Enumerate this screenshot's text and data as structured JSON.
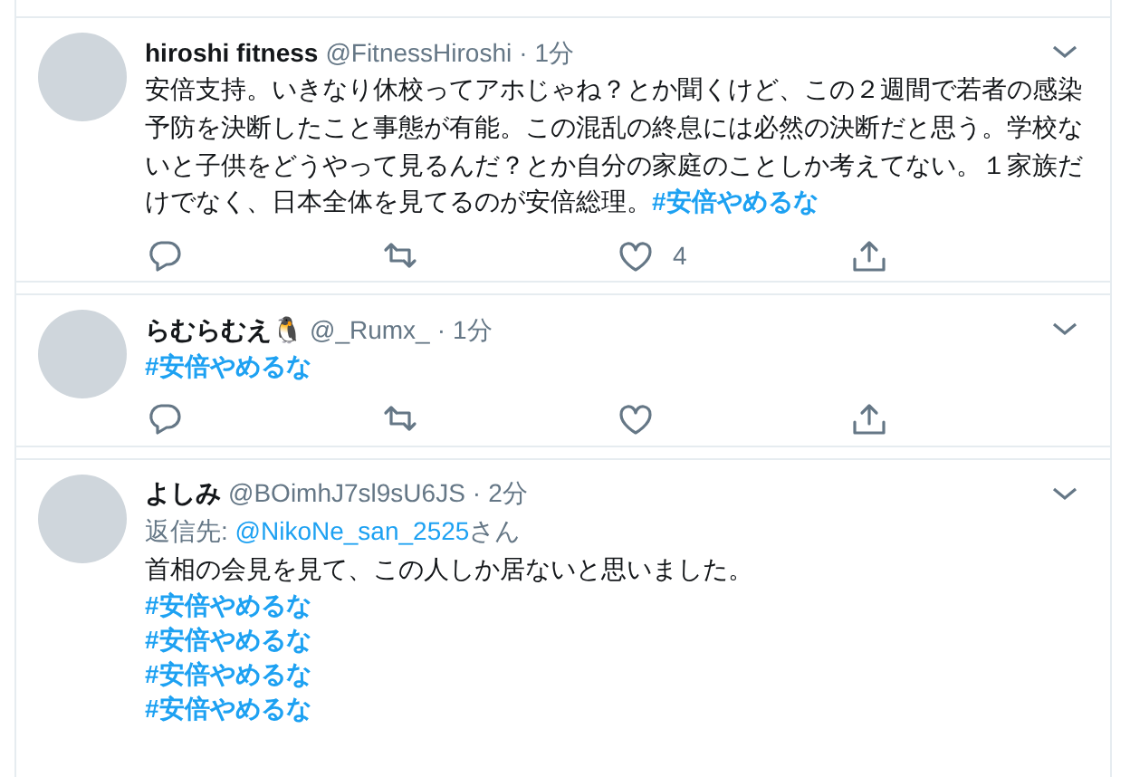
{
  "tweets": [
    {
      "name": "hiroshi fitness",
      "handle": "@FitnessHiroshi",
      "separator": "·",
      "time": "1分",
      "body": [
        {
          "kind": "text",
          "text": "安倍支持。いきなり休校ってアホじゃね？とか聞くけど、この２週間で若者の感染予防を決断したこと事態が有能。この混乱の終息には必然の決断だと思う。学校ないと子供をどうやって見るんだ？とか自分の家庭のことしか考えてない。１家族だけでなく、日本全体を見てるのが安倍総理。"
        },
        {
          "kind": "hashtag",
          "text": "#安倍やめるな"
        }
      ],
      "actions": [
        {
          "kind": "reply"
        },
        {
          "kind": "retweet"
        },
        {
          "kind": "like",
          "count": "4"
        },
        {
          "kind": "share"
        }
      ]
    },
    {
      "name": "らむらむえ🐧",
      "handle": "@_Rumx_",
      "separator": "·",
      "time": "1分",
      "body": [
        {
          "kind": "hashtag",
          "text": "#安倍やめるな"
        }
      ],
      "actions": [
        {
          "kind": "reply"
        },
        {
          "kind": "retweet"
        },
        {
          "kind": "like"
        },
        {
          "kind": "share"
        }
      ]
    },
    {
      "name": "よしみ",
      "handle": "@BOimhJ7sl9sU6JS",
      "separator": "·",
      "time": "2分",
      "reply_to": {
        "label": "返信先:",
        "mention": "@NikoNe_san_2525",
        "suffix": "さん"
      },
      "body": [
        {
          "kind": "text",
          "text": "首相の会見を見て、この人しか居ないと思いました。"
        }
      ],
      "hashtag_lines": [
        "#安倍やめるな",
        "#安倍やめるな",
        "#安倍やめるな",
        "#安倍やめるな"
      ]
    }
  ]
}
